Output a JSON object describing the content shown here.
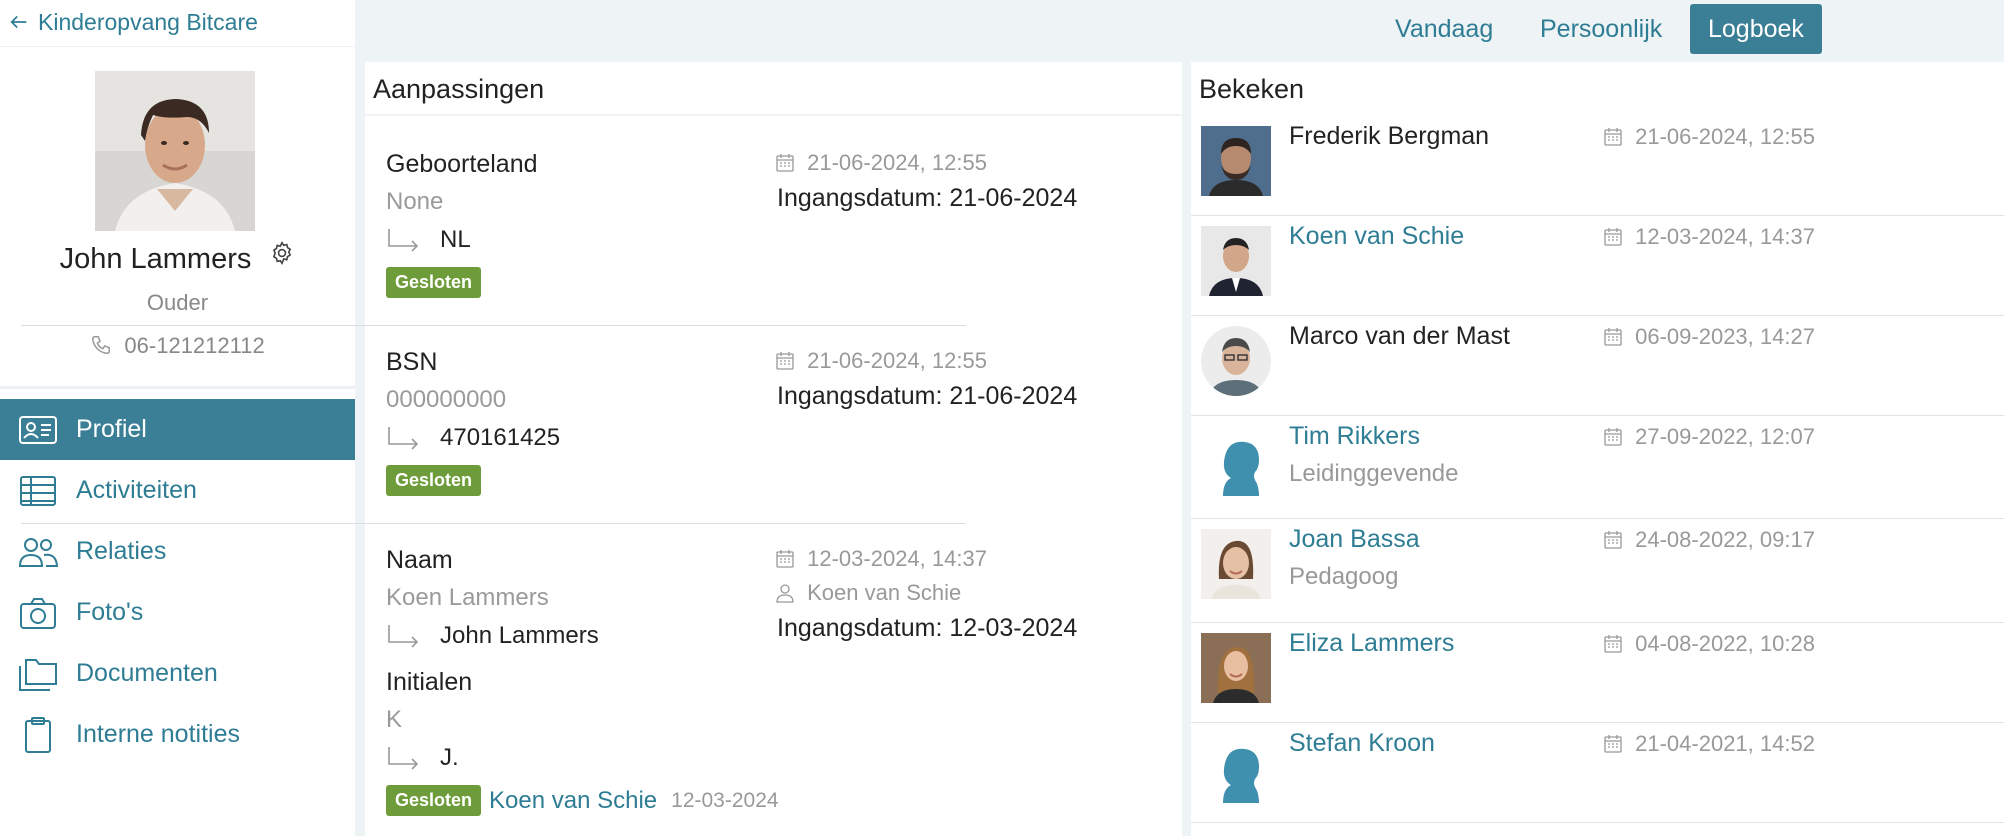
{
  "sidebar": {
    "back_label": "Kinderopvang Bitcare",
    "profile": {
      "name": "John Lammers",
      "role": "Ouder",
      "phone": "06-121212112"
    },
    "nav": [
      {
        "label": "Profiel",
        "icon": "id-card-icon",
        "active": true
      },
      {
        "label": "Activiteiten",
        "icon": "table-icon"
      },
      {
        "label": "Relaties",
        "icon": "people-icon"
      },
      {
        "label": "Foto's",
        "icon": "camera-icon"
      },
      {
        "label": "Documenten",
        "icon": "folders-icon"
      },
      {
        "label": "Interne notities",
        "icon": "clipboard-icon"
      }
    ]
  },
  "tabs": [
    {
      "label": "Vandaag"
    },
    {
      "label": "Persoonlijk"
    },
    {
      "label": "Logboek",
      "active": true
    }
  ],
  "changes": {
    "title": "Aanpassingen",
    "items": [
      {
        "field": "Geboorteland",
        "old": "None",
        "new": "NL",
        "status": "Gesloten",
        "timestamp": "21-06-2024, 12:55",
        "effective": "Ingangsdatum: 21-06-2024"
      },
      {
        "field": "BSN",
        "old": "000000000",
        "new": "470161425",
        "status": "Gesloten",
        "timestamp": "21-06-2024, 12:55",
        "effective": "Ingangsdatum: 21-06-2024"
      },
      {
        "field": "Naam",
        "old": "Koen Lammers",
        "new": "John Lammers",
        "field2": "Initialen",
        "old2": "K",
        "new2": "J.",
        "status": "Gesloten",
        "timestamp": "12-03-2024, 14:37",
        "user": "Koen van Schie",
        "effective": "Ingangsdatum: 12-03-2024",
        "closed_by": "Koen van Schie",
        "closed_date": "12-03-2024"
      }
    ]
  },
  "viewed": {
    "title": "Bekeken",
    "items": [
      {
        "name": "Frederik Bergman",
        "role": "",
        "timestamp": "21-06-2024, 12:55",
        "link": false
      },
      {
        "name": "Koen van Schie",
        "role": "",
        "timestamp": "12-03-2024, 14:37",
        "link": true
      },
      {
        "name": "Marco van der Mast",
        "role": "",
        "timestamp": "06-09-2023, 14:27",
        "link": false
      },
      {
        "name": "Tim Rikkers",
        "role": "Leidinggevende",
        "timestamp": "27-09-2022, 12:07",
        "link": true
      },
      {
        "name": "Joan Bassa",
        "role": "Pedagoog",
        "timestamp": "24-08-2022, 09:17",
        "link": true
      },
      {
        "name": "Eliza Lammers",
        "role": "",
        "timestamp": "04-08-2022, 10:28",
        "link": true
      },
      {
        "name": "Stefan Kroon",
        "role": "",
        "timestamp": "21-04-2021, 14:52",
        "link": true
      }
    ]
  },
  "colors": {
    "accent": "#3a7f96",
    "link": "#2e7d94",
    "badge": "#6f9c3a",
    "background": "#eef3f6"
  }
}
